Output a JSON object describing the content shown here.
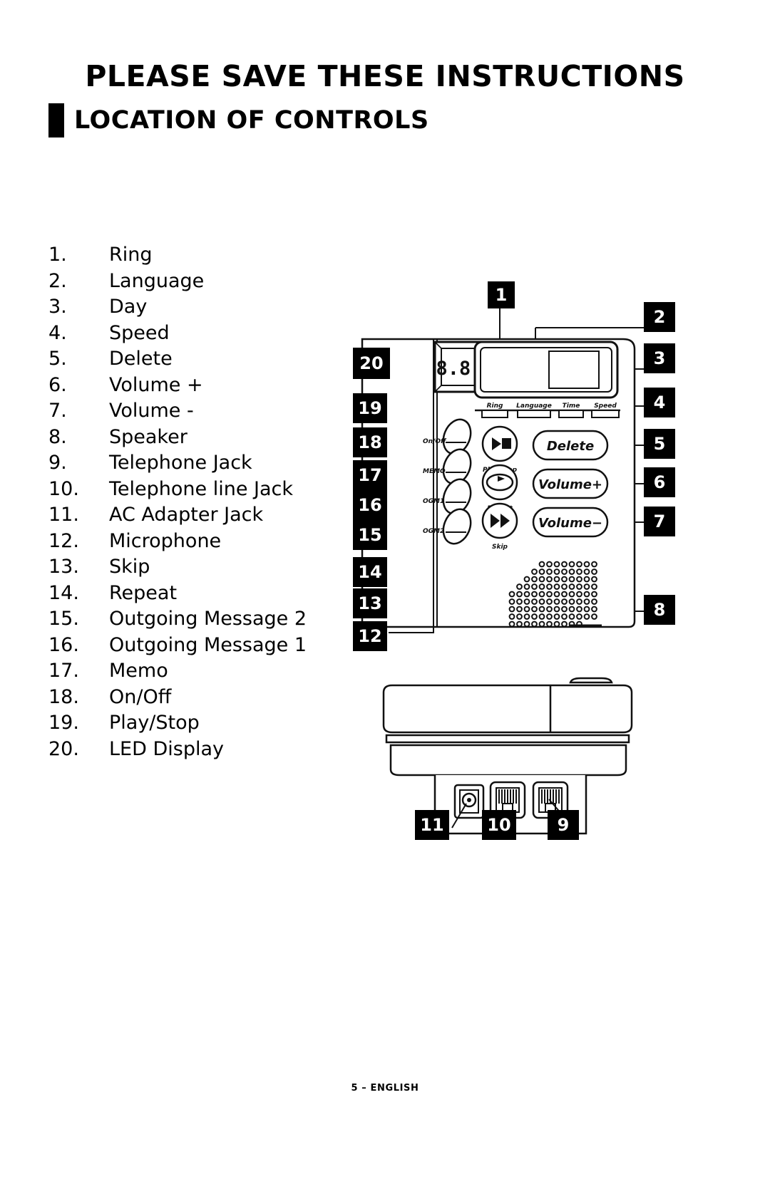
{
  "document": {
    "title": "PLEASE SAVE THESE INSTRUCTIONS",
    "section_title": "LOCATION OF CONTROLS",
    "footer": "5 – ENGLISH"
  },
  "legend": {
    "items": [
      {
        "num": "1.",
        "label": "Ring"
      },
      {
        "num": "2.",
        "label": "Language"
      },
      {
        "num": "3.",
        "label": "Day"
      },
      {
        "num": "4.",
        "label": "Speed"
      },
      {
        "num": "5.",
        "label": "Delete"
      },
      {
        "num": "6.",
        "label": "Volume +"
      },
      {
        "num": "7.",
        "label": "Volume -"
      },
      {
        "num": "8.",
        "label": "Speaker"
      },
      {
        "num": "9.",
        "label": "Telephone Jack"
      },
      {
        "num": "10.",
        "label": "Telephone line Jack"
      },
      {
        "num": "11.",
        "label": "AC Adapter Jack"
      },
      {
        "num": "12.",
        "label": "Microphone"
      },
      {
        "num": "13.",
        "label": "Skip"
      },
      {
        "num": "14.",
        "label": "Repeat"
      },
      {
        "num": "15.",
        "label": "Outgoing Message 2"
      },
      {
        "num": "16.",
        "label": "Outgoing Message 1"
      },
      {
        "num": "17.",
        "label": "Memo"
      },
      {
        "num": "18.",
        "label": "On/Off"
      },
      {
        "num": "19.",
        "label": "Play/Stop"
      },
      {
        "num": "20.",
        "label": "LED Display"
      }
    ]
  },
  "diagram": {
    "led_display_value": "8.8.",
    "indicator_labels": [
      "Ring",
      "Language",
      "Time",
      "Speed"
    ],
    "side_switch_labels": [
      "On/Off",
      "MEMO",
      "OGM1",
      "OGM2"
    ],
    "transport_labels": [
      "Play/Stop",
      "Repeat",
      "Skip"
    ],
    "panel_buttons": [
      "Delete",
      "Volume+",
      "Volume−"
    ],
    "callouts": [
      {
        "id": "1",
        "value": "1"
      },
      {
        "id": "2",
        "value": "2"
      },
      {
        "id": "3",
        "value": "3"
      },
      {
        "id": "4",
        "value": "4"
      },
      {
        "id": "5",
        "value": "5"
      },
      {
        "id": "6",
        "value": "6"
      },
      {
        "id": "7",
        "value": "7"
      },
      {
        "id": "8",
        "value": "8"
      },
      {
        "id": "9",
        "value": "9"
      },
      {
        "id": "10",
        "value": "10"
      },
      {
        "id": "11",
        "value": "11"
      },
      {
        "id": "12",
        "value": "12"
      },
      {
        "id": "13",
        "value": "13"
      },
      {
        "id": "14",
        "value": "14"
      },
      {
        "id": "15",
        "value": "15"
      },
      {
        "id": "16",
        "value": "16"
      },
      {
        "id": "17",
        "value": "17"
      },
      {
        "id": "18",
        "value": "18"
      },
      {
        "id": "19",
        "value": "19"
      },
      {
        "id": "20",
        "value": "20"
      }
    ]
  },
  "colors": {
    "ink": "#000000",
    "paper": "#ffffff"
  }
}
